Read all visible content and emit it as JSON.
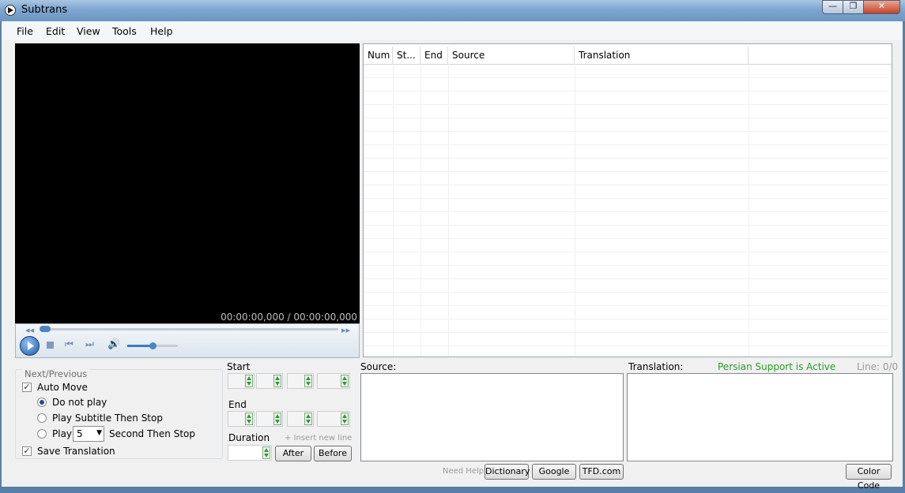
{
  "window": {
    "title": "Subtrans",
    "min": "—",
    "max": "❐",
    "close": "✕"
  },
  "menu": [
    "File",
    "Edit",
    "View",
    "Tools",
    "Help"
  ],
  "player": {
    "timecode": "00:00:00,000 / 00:00:00,000",
    "seek_fraction": 0.0,
    "volume_fraction": 0.5
  },
  "grid": {
    "columns": [
      "Num",
      "St...",
      "End",
      "Source",
      "Translation"
    ]
  },
  "next_previous": {
    "legend": "Next/Previous",
    "auto_move": "Auto Move",
    "do_not_play": "Do not play",
    "play_subtitle": "Play Subtitle Then Stop",
    "play": "Play",
    "seconds_value": "5",
    "seconds_suffix": "Second Then Stop",
    "save_translation": "Save Translation"
  },
  "timing": {
    "start": "Start",
    "end": "End",
    "duration": "Duration",
    "insert_hint": "+ Insert new line",
    "after": "After",
    "before": "Before"
  },
  "source": {
    "label": "Source:"
  },
  "translation": {
    "label": "Translation:",
    "persian": "Persian Support is Active",
    "line": "Line: 0/0"
  },
  "help": {
    "need_help": "Need Help?",
    "dictionary": "Dictionary",
    "google": "Google",
    "tfd": "TFD.com",
    "color_code": "Color Code"
  },
  "colors": {
    "persian_status": "#2a9a2a",
    "video_bg": "#000000"
  }
}
